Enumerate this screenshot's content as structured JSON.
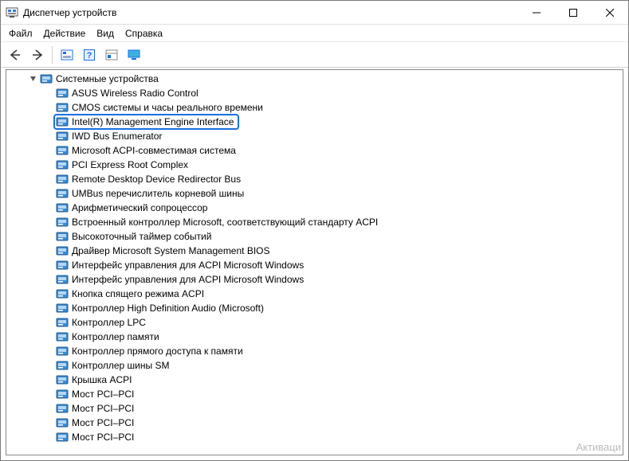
{
  "window": {
    "title": "Диспетчер устройств"
  },
  "menu": {
    "file": "Файл",
    "action": "Действие",
    "view": "Вид",
    "help": "Справка"
  },
  "tree": {
    "root_label": "Системные устройства",
    "items": [
      "ASUS Wireless Radio Control",
      "CMOS системы и часы реального времени",
      "Intel(R) Management Engine Interface",
      "IWD Bus Enumerator",
      "Microsoft ACPI-совместимая система",
      "PCI Express Root Complex",
      "Remote Desktop Device Redirector Bus",
      "UMBus перечислитель корневой шины",
      "Арифметический сопроцессор",
      "Встроенный контроллер Microsoft, соответствующий стандарту ACPI",
      "Высокоточный таймер событий",
      "Драйвер Microsoft System Management BIOS",
      "Интерфейс управления для ACPI Microsoft Windows",
      "Интерфейс управления для ACPI Microsoft Windows",
      "Кнопка спящего режима ACPI",
      "Контроллер High Definition Audio (Microsoft)",
      "Контроллер LPC",
      "Контроллер памяти",
      "Контроллер прямого доступа к памяти",
      "Контроллер шины SM",
      "Крышка ACPI",
      "Мост PCI–PCI",
      "Мост PCI–PCI",
      "Мост PCI–PCI",
      "Мост PCI–PCI"
    ],
    "highlight_index": 2
  },
  "watermark": "Активаци"
}
